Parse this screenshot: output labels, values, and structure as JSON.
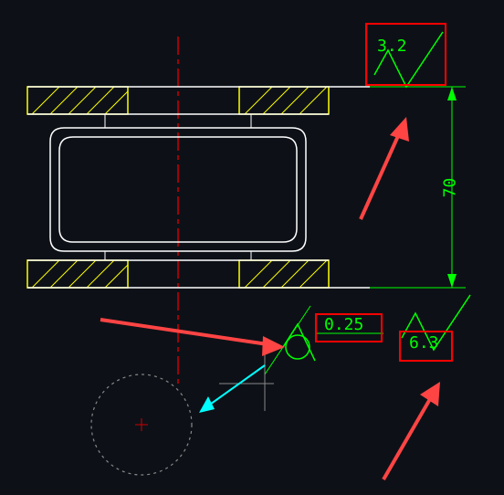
{
  "surface_roughness_top": "3.2",
  "surface_roughness_bottom_right": "6.3",
  "surface_roughness_bottom_value": "0.25",
  "dimension_vertical": "70",
  "colors": {
    "background": "#0d1117",
    "linework": "#ffffff",
    "hatch": "#ffff00",
    "centerline": "#cc0000",
    "dimension": "#00ff00",
    "construction": "#888888",
    "cyan": "#00ffff",
    "callout": "#ff0000"
  }
}
